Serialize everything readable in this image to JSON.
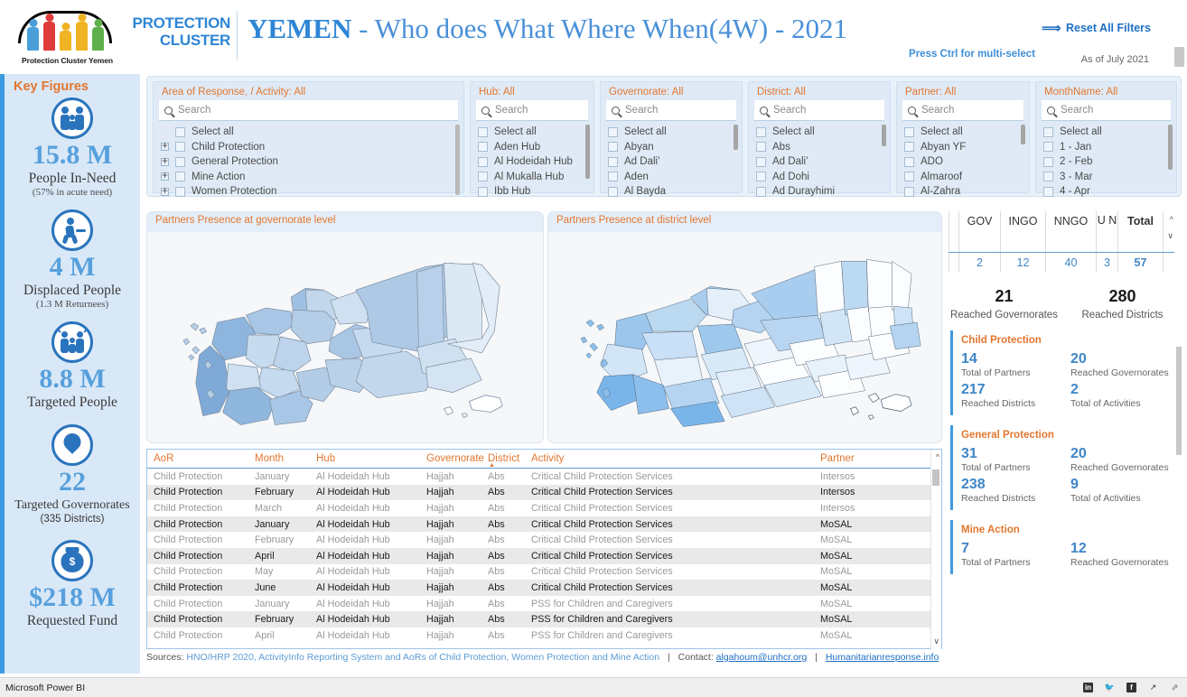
{
  "header": {
    "logo_caption": "Protection Cluster Yemen",
    "brand_line1": "PROTECTION",
    "brand_line2": "CLUSTER",
    "title_bold": "YEMEN",
    "title_rest": " - Who does What Where When(4W) - 2021",
    "reset_label": "Reset All Filters",
    "reset_icon": "reset-arrow-icon",
    "multiselect_note": "Press Ctrl for multi-select",
    "as_of": "As of July 2021"
  },
  "sidebar": {
    "title": "Key Figures",
    "figures": [
      {
        "icon": "family-icon",
        "value": "15.8 M",
        "label": "People In-Need",
        "sub": "(57% in acute need)"
      },
      {
        "icon": "displaced-icon",
        "value": "4 M",
        "label": "Displaced People",
        "sub": "(1.3 M Returnees)"
      },
      {
        "icon": "targeted-icon",
        "value": "8.8 M",
        "label": "Targeted People",
        "sub": ""
      },
      {
        "icon": "map-pin-icon",
        "value": "22",
        "label": "Targeted Governorates",
        "sub": "(335 Districts)"
      },
      {
        "icon": "money-bag-icon",
        "value": "$218 M",
        "label": "Requested Fund",
        "sub": ""
      }
    ]
  },
  "filters": {
    "search_placeholder": "Search",
    "search_icon": "search-icon",
    "panels": [
      {
        "title": "Area of Response, / Activity: All",
        "expandable": true,
        "items": [
          "Select all",
          "Child Protection",
          "General Protection",
          "Mine Action",
          "Women Protection"
        ]
      },
      {
        "title": "Hub: All",
        "expandable": false,
        "items": [
          "Select all",
          "Aden Hub",
          "Al Hodeidah Hub",
          "Al Mukalla Hub",
          "Ibb Hub"
        ]
      },
      {
        "title": "Governorate: All",
        "expandable": false,
        "items": [
          "Select all",
          "Abyan",
          "Ad Dali'",
          "Aden",
          "Al Bayda"
        ]
      },
      {
        "title": "District: All",
        "expandable": false,
        "items": [
          "Select all",
          "Abs",
          "Ad Dali'",
          "Ad Dohi",
          "Ad Durayhimi"
        ]
      },
      {
        "title": "Partner: All",
        "expandable": false,
        "items": [
          "Select all",
          "Abyan YF",
          "ADO",
          "Almaroof",
          "Al-Zahra"
        ]
      },
      {
        "title": "MonthName: All",
        "expandable": false,
        "items": [
          "Select all",
          "1 - Jan",
          "2 - Feb",
          "3 - Mar",
          "4 - Apr"
        ]
      }
    ]
  },
  "maps": {
    "gov": {
      "title": "Partners Presence at governorate level"
    },
    "dist": {
      "title": "Partners Presence at district level"
    }
  },
  "table": {
    "columns": [
      "AoR",
      "Month",
      "Hub",
      "Governorate",
      "District",
      "Activity",
      "Partner"
    ],
    "sorted_column": "District",
    "rows": [
      [
        "Child Protection",
        "January",
        "Al Hodeidah Hub",
        "Hajjah",
        "Abs",
        "Critical Child Protection Services",
        "Intersos"
      ],
      [
        "Child Protection",
        "February",
        "Al Hodeidah Hub",
        "Hajjah",
        "Abs",
        "Critical Child Protection Services",
        "Intersos"
      ],
      [
        "Child Protection",
        "March",
        "Al Hodeidah Hub",
        "Hajjah",
        "Abs",
        "Critical Child Protection Services",
        "Intersos"
      ],
      [
        "Child Protection",
        "January",
        "Al Hodeidah Hub",
        "Hajjah",
        "Abs",
        "Critical Child Protection Services",
        "MoSAL"
      ],
      [
        "Child Protection",
        "February",
        "Al Hodeidah Hub",
        "Hajjah",
        "Abs",
        "Critical Child Protection Services",
        "MoSAL"
      ],
      [
        "Child Protection",
        "April",
        "Al Hodeidah Hub",
        "Hajjah",
        "Abs",
        "Critical Child Protection Services",
        "MoSAL"
      ],
      [
        "Child Protection",
        "May",
        "Al Hodeidah Hub",
        "Hajjah",
        "Abs",
        "Critical Child Protection Services",
        "MoSAL"
      ],
      [
        "Child Protection",
        "June",
        "Al Hodeidah Hub",
        "Hajjah",
        "Abs",
        "Critical Child Protection Services",
        "MoSAL"
      ],
      [
        "Child Protection",
        "January",
        "Al Hodeidah Hub",
        "Hajjah",
        "Abs",
        "PSS for Children and Caregivers",
        "MoSAL"
      ],
      [
        "Child Protection",
        "February",
        "Al Hodeidah Hub",
        "Hajjah",
        "Abs",
        "PSS for Children and Caregivers",
        "MoSAL"
      ],
      [
        "Child Protection",
        "April",
        "Al Hodeidah Hub",
        "Hajjah",
        "Abs",
        "PSS for Children and Caregivers",
        "MoSAL"
      ]
    ]
  },
  "stats": {
    "partner_table": {
      "columns": [
        "",
        "GOV",
        "INGO",
        "NNGO",
        "U N",
        "Total"
      ],
      "row": [
        "",
        "2",
        "12",
        "40",
        "3",
        "57"
      ]
    },
    "reached": [
      {
        "value": "21",
        "label": "Reached Governorates"
      },
      {
        "value": "280",
        "label": "Reached Districts"
      }
    ],
    "aor_cards": [
      {
        "title": "Child Protection",
        "metrics": [
          {
            "value": "14",
            "label": "Total of Partners"
          },
          {
            "value": "20",
            "label": "Reached Governorates"
          },
          {
            "value": "217",
            "label": "Reached Districts"
          },
          {
            "value": "2",
            "label": "Total of Activities"
          }
        ]
      },
      {
        "title": "General Protection",
        "metrics": [
          {
            "value": "31",
            "label": "Total of Partners"
          },
          {
            "value": "20",
            "label": "Reached Governorates"
          },
          {
            "value": "238",
            "label": "Reached Districts"
          },
          {
            "value": "9",
            "label": "Total of Activities"
          }
        ]
      },
      {
        "title": "Mine Action",
        "metrics": [
          {
            "value": "7",
            "label": "Total of Partners"
          },
          {
            "value": "12",
            "label": "Reached Governorates"
          }
        ]
      }
    ]
  },
  "footer": {
    "sources_label": "Sources:",
    "sources_text": "HNO/HRP 2020, ActivityInfo Reporting System and AoRs of Child Protection, Women Protection and Mine Action",
    "sep1": "|",
    "contact_label": "Contact:",
    "contact_email": "algahoum@unhcr.org",
    "sep2": "|",
    "site_link": "Humanitarianresponse.info"
  },
  "taskbar": {
    "label": "Microsoft Power BI",
    "icons": [
      "linkedin-icon",
      "twitter-icon",
      "facebook-icon",
      "share-icon",
      "fullscreen-icon"
    ]
  }
}
